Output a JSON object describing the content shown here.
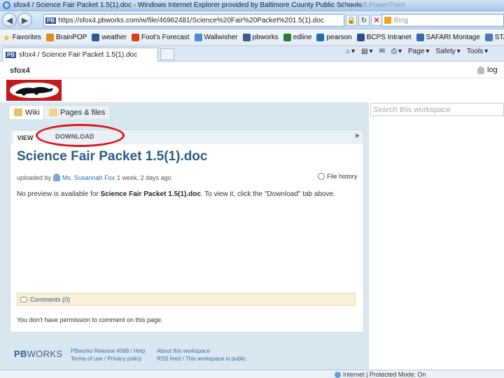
{
  "browser": {
    "window_title": "sfox4 / Science Fair Packet 1.5(1).doc - Windows Internet Explorer provided by Baltimore County Public Schools",
    "ghost_title": "Microsoft PowerPoint",
    "url": "https://sfox4.pbworks.com/w/file/46962481/Science%20Fair%20Packet%201.5(1).doc",
    "url_favicon": "PB",
    "search_placeholder": "Bing",
    "favorites": [
      {
        "label": "Favorites",
        "color": "#f2b90c"
      },
      {
        "label": "BrainPOP",
        "color": "#e28a1c"
      },
      {
        "label": "weather",
        "color": "#2f5c97"
      },
      {
        "label": "Foot's Forecast",
        "color": "#d6401a"
      },
      {
        "label": "Wallwisher",
        "color": "#4a8bd2"
      },
      {
        "label": "pbworks",
        "color": "#3c5a8a"
      },
      {
        "label": "edline",
        "color": "#2b7c3c"
      },
      {
        "label": "pearson",
        "color": "#1f6fb5"
      },
      {
        "label": "BCPS Intranet",
        "color": "#2c4f8a"
      },
      {
        "label": "SAFARI Montage",
        "color": "#3a69b0"
      },
      {
        "label": "STARS L",
        "color": "#4c7ac0"
      }
    ],
    "tab_title": "sfox4 / Science Fair Packet 1.5(1).doc",
    "tab_favicon": "PB",
    "commands": {
      "page": "Page",
      "safety": "Safety",
      "tools": "Tools"
    },
    "status": "Internet | Protected Mode: On"
  },
  "site": {
    "name": "sfox4",
    "login": "log"
  },
  "workspace_tabs": {
    "wiki": "Wiki",
    "pages": "Pages & files"
  },
  "workspace_search_placeholder": "Search this workspace",
  "file_page": {
    "view_tab": "VIEW",
    "download_tab": "DOWNLOAD",
    "title": "Science Fair Packet 1.5(1).doc",
    "uploaded_prefix": "uploaded by",
    "author": "Ms. Susannah Fox",
    "uploaded_when": "1 week, 2 days ago",
    "file_history": "File history",
    "no_preview_before": "No preview is available for",
    "no_preview_file": "Science Fair Packet 1.5(1).doc",
    "no_preview_after": ". To view it, click the \"Download\" tab above.",
    "comments": "Comments (0)",
    "no_permission": "You don't have permission to comment on this page."
  },
  "footer": {
    "brand_bold": "PB",
    "brand_light": "WORKS",
    "col1_line1": "PBworks Release #588 / Help",
    "col1_line2": "Terms of use / Privacy policy",
    "col2_line1": "About this workspace",
    "col2_line2": "RSS feed / This workspace is public"
  },
  "colors": {
    "annotation": "#e0121b",
    "logo_background": "#c21a1f",
    "title_blue": "#2c5b84",
    "canvas": "#d9e7f1"
  }
}
